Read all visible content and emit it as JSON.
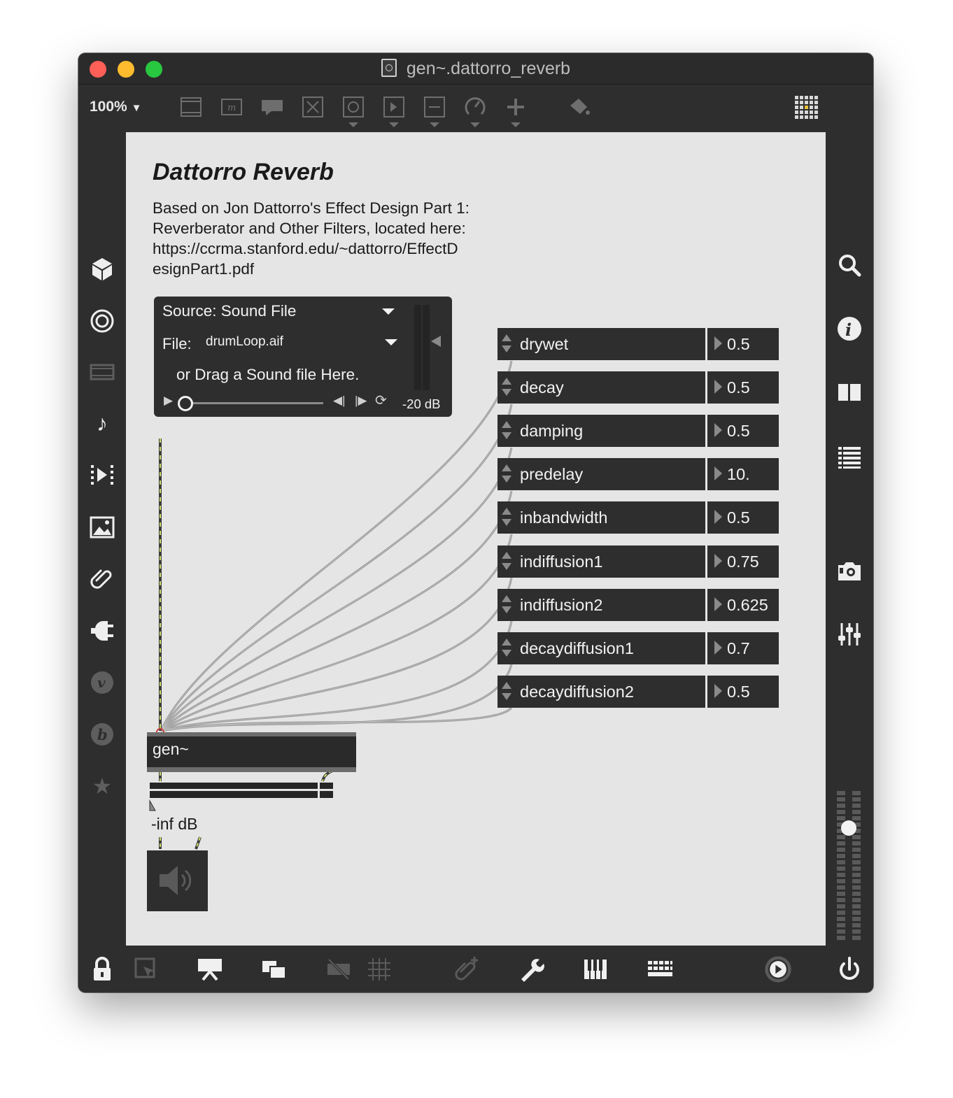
{
  "window": {
    "title": "gen~.dattorro_reverb"
  },
  "toolbar": {
    "zoom": "100%"
  },
  "patch": {
    "heading": "Dattorro Reverb",
    "description": [
      "Based on Jon Dattorro's Effect Design Part 1:",
      "Reverberator and Other Filters, located here:",
      "https://ccrma.stanford.edu/~dattorro/EffectD",
      "esignPart1.pdf"
    ],
    "player": {
      "source": "Source: Sound File",
      "file_label": "File:",
      "file_name": "drumLoop.aif",
      "drag_hint": "or Drag a Sound file Here.",
      "gain": "-20 dB"
    },
    "params": [
      {
        "name": "drywet",
        "value": "0.5"
      },
      {
        "name": "decay",
        "value": "0.5"
      },
      {
        "name": "damping",
        "value": "0.5"
      },
      {
        "name": "predelay",
        "value": "10."
      },
      {
        "name": "inbandwidth",
        "value": "0.5"
      },
      {
        "name": "indiffusion1",
        "value": "0.75"
      },
      {
        "name": "indiffusion2",
        "value": "0.625"
      },
      {
        "name": "decaydiffusion1",
        "value": "0.7"
      },
      {
        "name": "decaydiffusion2",
        "value": "0.5"
      }
    ],
    "gen_object": "gen~",
    "output_level": "-inf dB"
  },
  "icons": {
    "left_sidebar": [
      "cube-icon",
      "target-icon",
      "video-icon",
      "music-note-icon",
      "frames-icon",
      "image-icon",
      "paperclip-icon",
      "plug-icon",
      "v-icon",
      "b-icon",
      "star-icon"
    ],
    "right_sidebar": [
      "search-icon",
      "info-icon",
      "columns-icon",
      "list-icon",
      "camera-icon",
      "mixer-icon"
    ],
    "bottom": [
      "lock-icon",
      "select-icon",
      "presentation-icon",
      "windows-icon",
      "mute-icon",
      "grid-icon",
      "attach-icon",
      "wrench-icon",
      "piano-icon",
      "keyboard-icon",
      "audio-play-icon",
      "power-icon"
    ]
  },
  "colors": {
    "canvas": "#e5e5e5",
    "chrome": "#2e2e2e",
    "patch_cord_signal": "#c8e06a"
  }
}
